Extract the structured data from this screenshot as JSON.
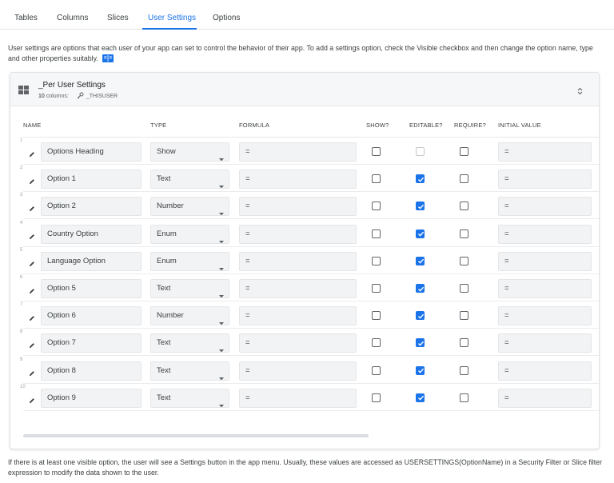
{
  "tabs": [
    {
      "label": "Tables"
    },
    {
      "label": "Columns"
    },
    {
      "label": "Slices"
    },
    {
      "label": "User Settings"
    },
    {
      "label": "Options"
    }
  ],
  "active_tab": "User Settings",
  "intro_text": "User settings are options that each user of your app can set to control the behavior of their app. To add a settings option, check the Visible checkbox and then change the option name, type and other properties suitably.",
  "table": {
    "title": "_Per User Settings",
    "columns_count": "10",
    "columns_label": "columns:",
    "key_column": "_THISUSER"
  },
  "headers": {
    "name": "NAME",
    "type": "TYPE",
    "formula": "FORMULA",
    "show": "SHOW?",
    "editable": "EDITABLE?",
    "require": "REQUIRE?",
    "initial": "INITIAL VALUE"
  },
  "rows": [
    {
      "num": "1",
      "name": "Options Heading",
      "type": "Show",
      "formula": "=",
      "show": false,
      "editable": false,
      "editable_disabled": true,
      "require": false,
      "initial": "="
    },
    {
      "num": "2",
      "name": "Option 1",
      "type": "Text",
      "formula": "=",
      "show": false,
      "editable": true,
      "require": false,
      "initial": "="
    },
    {
      "num": "3",
      "name": "Option 2",
      "type": "Number",
      "formula": "=",
      "show": false,
      "editable": true,
      "require": false,
      "initial": "="
    },
    {
      "num": "4",
      "name": "Country Option",
      "type": "Enum",
      "formula": "=",
      "show": false,
      "editable": true,
      "require": false,
      "initial": "="
    },
    {
      "num": "5",
      "name": "Language Option",
      "type": "Enum",
      "formula": "=",
      "show": false,
      "editable": true,
      "require": false,
      "initial": "="
    },
    {
      "num": "6",
      "name": "Option 5",
      "type": "Text",
      "formula": "=",
      "show": false,
      "editable": true,
      "require": false,
      "initial": "="
    },
    {
      "num": "7",
      "name": "Option 6",
      "type": "Number",
      "formula": "=",
      "show": false,
      "editable": true,
      "require": false,
      "initial": "="
    },
    {
      "num": "8",
      "name": "Option 7",
      "type": "Text",
      "formula": "=",
      "show": false,
      "editable": true,
      "require": false,
      "initial": "="
    },
    {
      "num": "9",
      "name": "Option 8",
      "type": "Text",
      "formula": "=",
      "show": false,
      "editable": true,
      "require": false,
      "initial": "="
    },
    {
      "num": "10",
      "name": "Option 9",
      "type": "Text",
      "formula": "=",
      "show": false,
      "editable": true,
      "require": false,
      "initial": "="
    }
  ],
  "footer_text": "If there is at least one visible option, the user will see a Settings button in the app menu. Usually, these values are accessed as USERSETTINGS(OptionName) in a Security Filter or Slice filter expression to modify the data shown to the user.",
  "colors": {
    "accent": "#1a73e8",
    "header_bg": "#f6f7f8",
    "field_bg": "#f1f3f4"
  },
  "icons": {
    "layout": "grid-icon",
    "key": "key-icon",
    "expand": "unfold-icon",
    "edit": "pencil-icon",
    "docs": "book-icon"
  }
}
